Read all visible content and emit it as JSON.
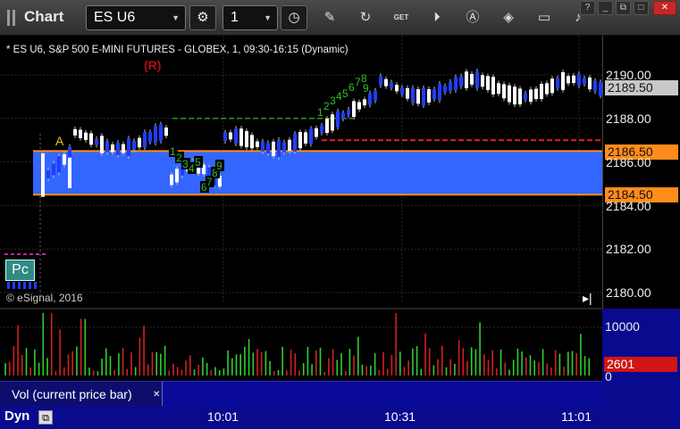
{
  "window": {
    "title": "Chart",
    "symbol": "ES U6",
    "interval": "1",
    "controls": {
      "minimize": "?",
      "maximize": "□",
      "close": "✕"
    }
  },
  "toolbar": {
    "icons": [
      "settings-icon",
      "clock-icon",
      "pencil-icon",
      "refresh-icon",
      "get-icon",
      "play-icon",
      "a-icon",
      "tag-icon",
      "chat-icon",
      "twitter-icon"
    ],
    "get_label": "GET"
  },
  "chart": {
    "subtitle": "* ES U6, S&P 500 E-MINI FUTURES - GLOBEX, 1, 09:30-16:15 (Dynamic)",
    "copyright": "© eSignal, 2016",
    "pc_badge": "Pc",
    "r_marker": "(R)",
    "a_marker": "A",
    "scroll_end": "▸|",
    "y_ticks": [
      "2190.00",
      "2188.00",
      "2186.00",
      "2184.00",
      "2182.00",
      "2180.00"
    ],
    "last_price": "2189.50",
    "zone_top": "2186.50",
    "zone_bottom": "2184.50",
    "colors": {
      "zone": "#3366ff",
      "zone_line": "#ff8c1a",
      "up_bar": "#ffffff",
      "down_bar": "#1f3dff",
      "badge": "#ff8c1a",
      "last_badge": "#c8c8c8",
      "red_dash": "#e52020",
      "green_dash": "#1f9a1f",
      "pink_dash": "#ff33cc"
    }
  },
  "volume": {
    "label": "Vol (current price bar)",
    "close": "✕",
    "y_ticks": [
      "10000",
      "0"
    ],
    "last_volume": "2601"
  },
  "time_axis": {
    "labels": [
      "10:01",
      "10:31",
      "11:01"
    ],
    "mode": "Dyn"
  }
}
